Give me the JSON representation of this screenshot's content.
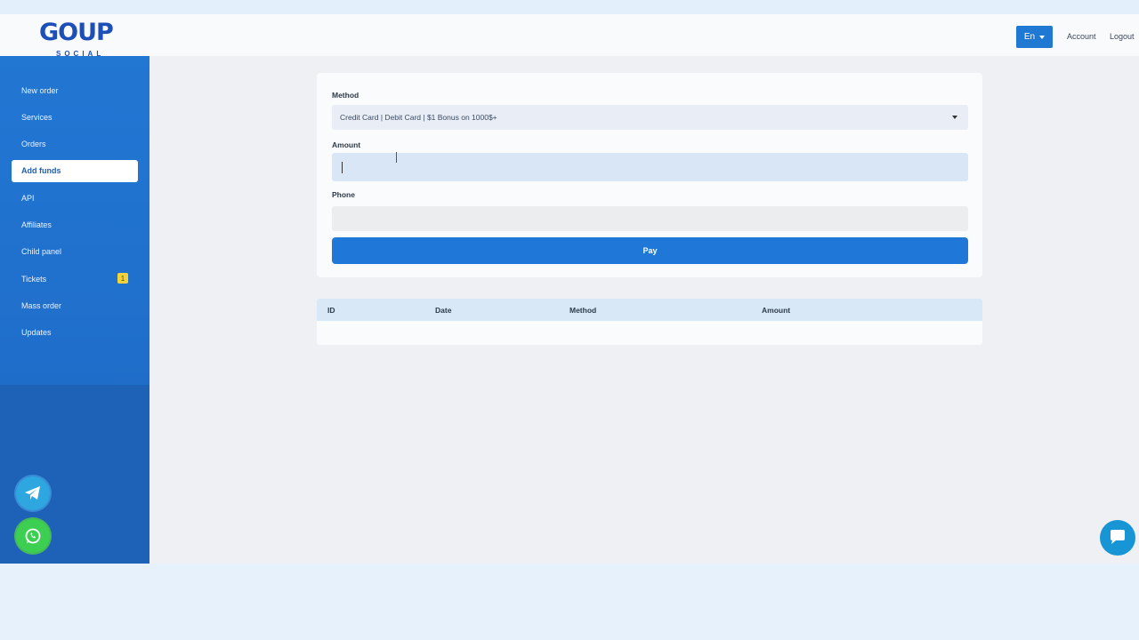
{
  "header": {
    "logo_text": "GOUP",
    "logo_sub": "SOCIAL",
    "lang_label": "En",
    "account_label": "Account",
    "logout_label": "Logout"
  },
  "sidebar": {
    "items": [
      {
        "label": "New order"
      },
      {
        "label": "Services"
      },
      {
        "label": "Orders"
      },
      {
        "label": "Add funds",
        "active": true
      },
      {
        "label": "API"
      },
      {
        "label": "Affiliates"
      },
      {
        "label": "Child panel"
      },
      {
        "label": "Tickets",
        "badge": "1"
      },
      {
        "label": "Mass order"
      },
      {
        "label": "Updates"
      }
    ]
  },
  "form": {
    "method_label": "Method",
    "method_value": "Credit Card | Debit Card | $1 Bonus on 1000$+",
    "amount_label": "Amount",
    "amount_value": "",
    "phone_label": "Phone",
    "phone_value": "",
    "pay_label": "Pay"
  },
  "history_table": {
    "columns": [
      "ID",
      "Date",
      "Method",
      "Amount"
    ],
    "rows": []
  },
  "colors": {
    "accent": "#1f78d8",
    "sidebar": "#2277d3",
    "badge": "#f4d23a"
  }
}
